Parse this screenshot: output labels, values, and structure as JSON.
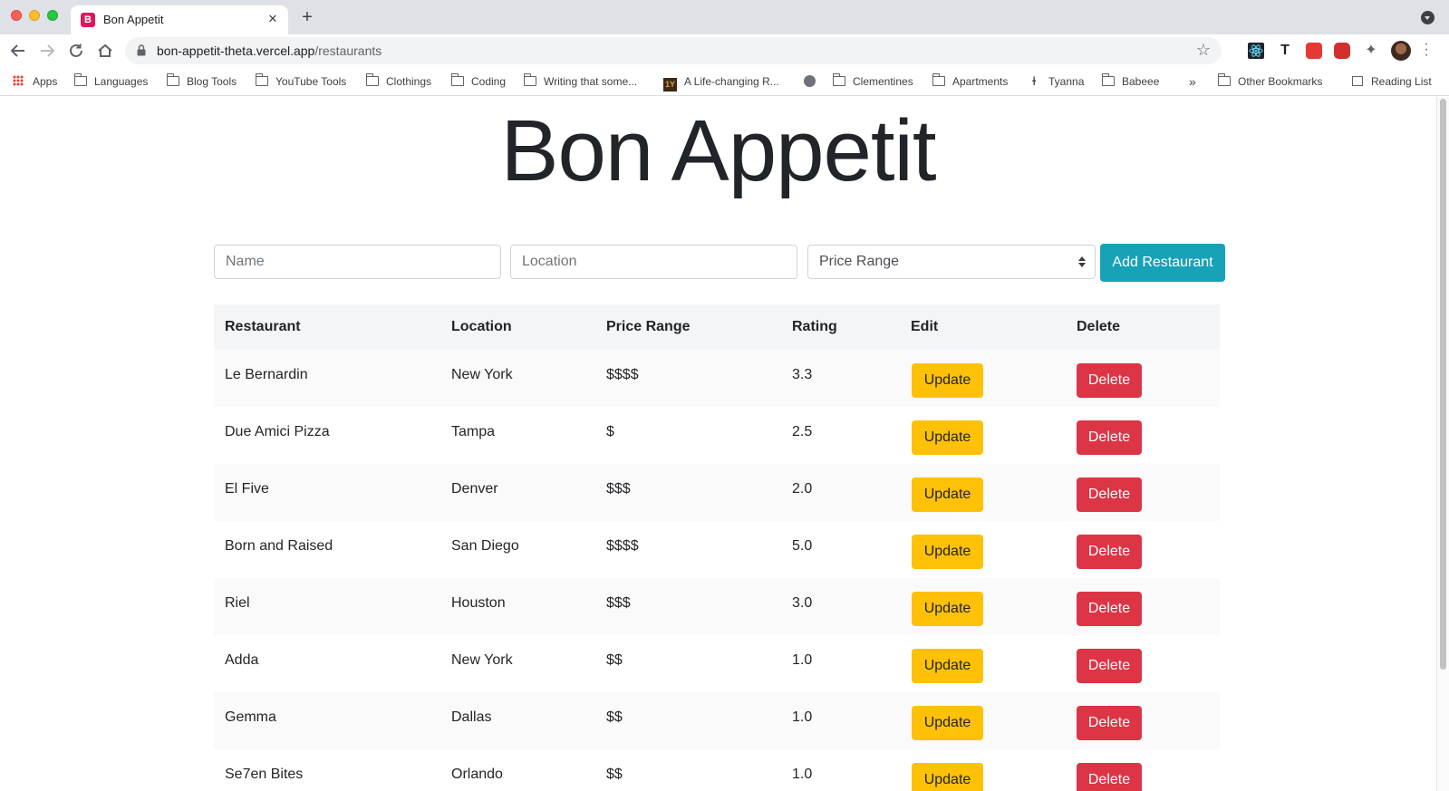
{
  "browser": {
    "tab_title": "Bon Appetit",
    "tab_favicon_letter": "B",
    "url_host": "bon-appetit-theta.vercel.app",
    "url_path": "/restaurants",
    "bookmarks": [
      {
        "label": "Apps",
        "icon": "apps-grid-icon"
      },
      {
        "label": "Languages",
        "icon": "folder-icon"
      },
      {
        "label": "Blog Tools",
        "icon": "folder-icon"
      },
      {
        "label": "YouTube Tools",
        "icon": "folder-icon"
      },
      {
        "label": "Clothings",
        "icon": "folder-icon"
      },
      {
        "label": "Coding",
        "icon": "folder-icon"
      },
      {
        "label": "Writing that some...",
        "icon": "folder-icon"
      },
      {
        "label": "A Life-changing R...",
        "icon": "site-icon"
      },
      {
        "label": "",
        "icon": "globe-icon"
      },
      {
        "label": "Clementines",
        "icon": "folder-icon"
      },
      {
        "label": "Apartments",
        "icon": "folder-icon"
      },
      {
        "label": "Tyanna",
        "icon": "site-icon"
      },
      {
        "label": "Babeee",
        "icon": "folder-icon"
      },
      {
        "label": "»",
        "icon": "overflow-chevron"
      },
      {
        "label": "Other Bookmarks",
        "icon": "folder-icon"
      },
      {
        "label": "Reading List",
        "icon": "reading-list-icon"
      }
    ]
  },
  "page": {
    "title": "Bon Appetit",
    "form": {
      "name_placeholder": "Name",
      "location_placeholder": "Location",
      "price_select_value": "Price Range",
      "add_button": "Add Restaurant"
    },
    "table": {
      "headers": [
        "Restaurant",
        "Location",
        "Price Range",
        "Rating",
        "Edit",
        "Delete"
      ],
      "update_label": "Update",
      "delete_label": "Delete",
      "rows": [
        {
          "name": "Le Bernardin",
          "location": "New York",
          "price": "$$$$",
          "rating": "3.3"
        },
        {
          "name": "Due Amici Pizza",
          "location": "Tampa",
          "price": "$",
          "rating": "2.5"
        },
        {
          "name": "El Five",
          "location": "Denver",
          "price": "$$$",
          "rating": "2.0"
        },
        {
          "name": "Born and Raised",
          "location": "San Diego",
          "price": "$$$$",
          "rating": "5.0"
        },
        {
          "name": "Riel",
          "location": "Houston",
          "price": "$$$",
          "rating": "3.0"
        },
        {
          "name": "Adda",
          "location": "New York",
          "price": "$$",
          "rating": "1.0"
        },
        {
          "name": "Gemma",
          "location": "Dallas",
          "price": "$$",
          "rating": "1.0"
        },
        {
          "name": "Se7en Bites",
          "location": "Orlando",
          "price": "$$",
          "rating": "1.0"
        }
      ]
    }
  },
  "colors": {
    "add_button": "#17a2b8",
    "update_button": "#ffc107",
    "delete_button": "#dc3545"
  }
}
